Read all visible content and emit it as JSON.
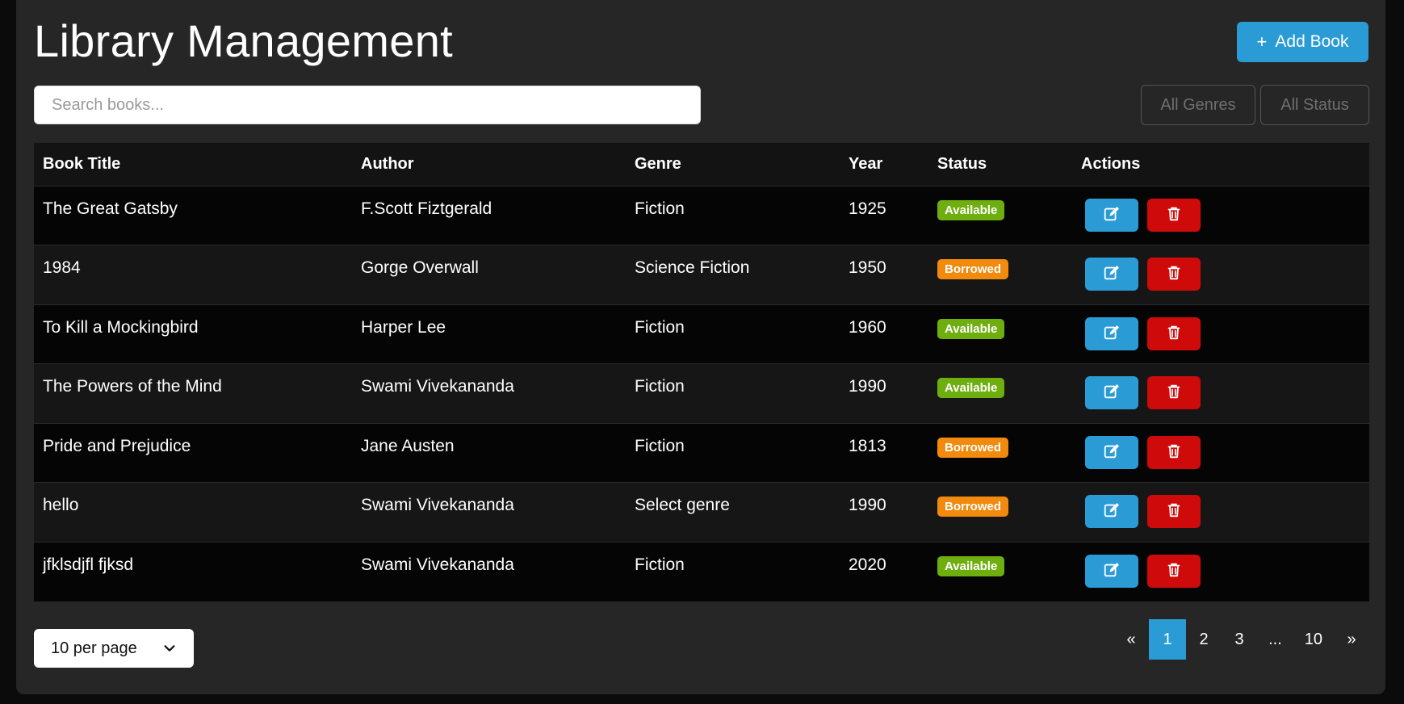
{
  "header": {
    "title": "Library Management",
    "add_label": "Add Book"
  },
  "search": {
    "placeholder": "Search books..."
  },
  "filters": {
    "genre": "All Genres",
    "status": "All Status"
  },
  "table": {
    "columns": [
      "Book Title",
      "Author",
      "Genre",
      "Year",
      "Status",
      "Actions"
    ],
    "rows": [
      {
        "title": "The Great Gatsby",
        "author": "F.Scott Fiztgerald",
        "genre": "Fiction",
        "year": "1925",
        "status": "Available"
      },
      {
        "title": "1984",
        "author": "Gorge Overwall",
        "genre": "Science Fiction",
        "year": "1950",
        "status": "Borrowed"
      },
      {
        "title": "To Kill a Mockingbird",
        "author": "Harper Lee",
        "genre": "Fiction",
        "year": "1960",
        "status": "Available"
      },
      {
        "title": "The Powers of the Mind",
        "author": "Swami Vivekananda",
        "genre": "Fiction",
        "year": "1990",
        "status": "Available"
      },
      {
        "title": "Pride and Prejudice",
        "author": "Jane Austen",
        "genre": "Fiction",
        "year": "1813",
        "status": "Borrowed"
      },
      {
        "title": "hello",
        "author": "Swami Vivekananda",
        "genre": "Select genre",
        "year": "1990",
        "status": "Borrowed"
      },
      {
        "title": "jfklsdjfl fjksd",
        "author": "Swami Vivekananda",
        "genre": "Fiction",
        "year": "2020",
        "status": "Available"
      }
    ]
  },
  "per_page": {
    "label": "10 per page"
  },
  "pagination": {
    "prev": "«",
    "next": "»",
    "pages": [
      "1",
      "2",
      "3",
      "...",
      "10"
    ],
    "current": "1"
  },
  "colors": {
    "accent": "#2b9bd6",
    "danger": "#cf0a0a",
    "available": "#6fae0f",
    "borrowed": "#f28a0e",
    "panel": "#262626"
  },
  "icons": {
    "add": "plus-icon",
    "edit": "edit-icon",
    "delete": "trash-icon",
    "dropdown": "chevron-down-icon"
  }
}
